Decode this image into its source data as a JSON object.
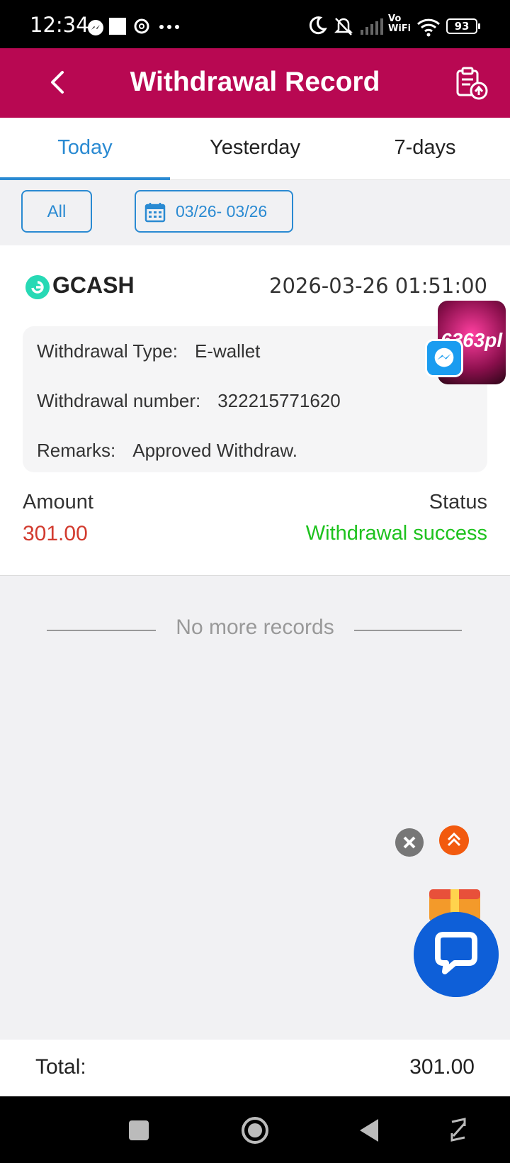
{
  "status_bar": {
    "time": "12:34",
    "vo": "Vo",
    "wifi": "WiFi",
    "battery": "93"
  },
  "header": {
    "title": "Withdrawal Record"
  },
  "tabs": [
    {
      "label": "Today",
      "active": true
    },
    {
      "label": "Yesterday",
      "active": false
    },
    {
      "label": "7-days",
      "active": false
    }
  ],
  "filters": {
    "all_label": "All",
    "date_range": "03/26- 03/26"
  },
  "record": {
    "method": "GCASH",
    "datetime": "2026-03-26 01:51:00",
    "type_label": "Withdrawal Type:",
    "type_value": "E-wallet",
    "number_label": "Withdrawal number:",
    "number_value": "322215771620",
    "remarks_label": "Remarks:",
    "remarks_value": "Approved Withdraw.",
    "amount_label": "Amount",
    "amount_value": "301.00",
    "status_label": "Status",
    "status_value": "Withdrawal success"
  },
  "no_more": "No more records",
  "floating": {
    "avatar_text": "6363pl"
  },
  "total": {
    "label": "Total:",
    "value": "301.00"
  },
  "colors": {
    "header": "#b80852",
    "accent": "#2a8ad2",
    "amount": "#d23b2f",
    "success": "#1ec21e"
  }
}
